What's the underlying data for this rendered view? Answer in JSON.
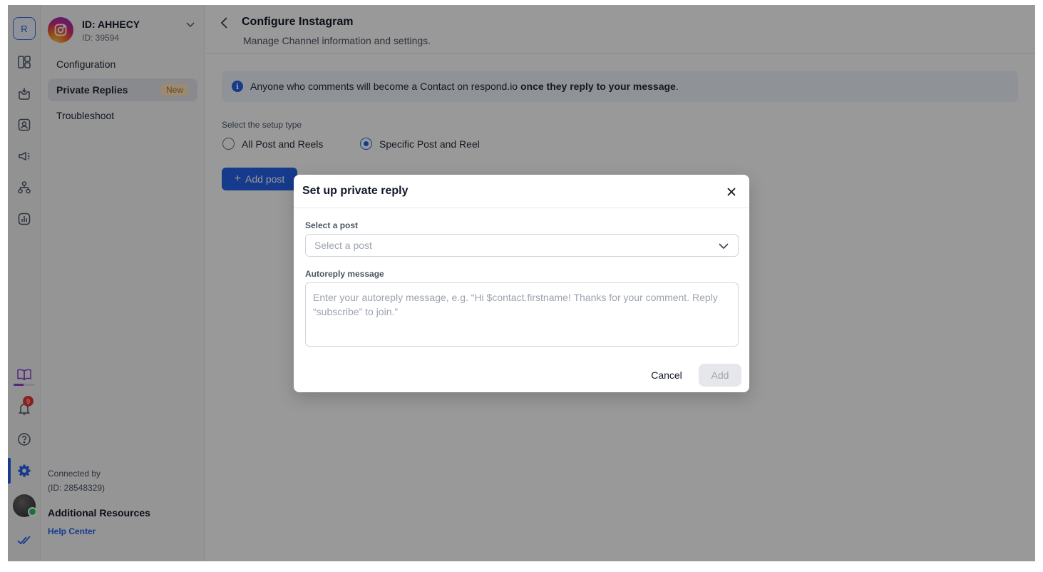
{
  "rail": {
    "workspace_initial": "R",
    "notification_count": "9",
    "onboarding_progress": 0.45,
    "icons": [
      "dashboard-icon",
      "inbox-icon",
      "contacts-icon",
      "broadcasts-icon",
      "workflows-icon",
      "reports-icon",
      "onboarding-book-icon",
      "notifications-bell-icon",
      "help-icon",
      "settings-gear-icon",
      "user-avatar",
      "respond-logo-icon"
    ]
  },
  "sidebar": {
    "account_title": "ID: AHHECY",
    "account_id": "ID: 39594",
    "items": [
      {
        "label": "Configuration"
      },
      {
        "label": "Private Replies",
        "badge": "New"
      },
      {
        "label": "Troubleshoot"
      }
    ],
    "connected_by_label": "Connected by",
    "connected_by_id": "(ID: 28548329)",
    "resources_title": "Additional Resources",
    "help_center": "Help Center"
  },
  "header": {
    "title": "Configure Instagram",
    "subtitle": "Manage Channel information and settings."
  },
  "info_banner": {
    "text_plain": "Anyone who comments will become a Contact on respond.io ",
    "text_bold": "once they reply to your message",
    "text_end": "."
  },
  "setup": {
    "label": "Select the setup type",
    "options": [
      {
        "label": "All Post and Reels",
        "selected": false
      },
      {
        "label": "Specific Post and Reel",
        "selected": true
      }
    ],
    "add_post_label": "Add post"
  },
  "modal": {
    "title": "Set up private reply",
    "post_label": "Select a post",
    "post_placeholder": "Select a post",
    "message_label": "Autoreply message",
    "message_placeholder": "Enter your autoreply message, e.g. “Hi $contact.firstname! Thanks for your comment. Reply “subscribe” to join.”",
    "cancel_label": "Cancel",
    "add_label": "Add"
  },
  "colors": {
    "accent": "#2563eb",
    "new_badge_bg": "#fde7c2",
    "new_badge_text": "#b7791f",
    "notification_badge": "#e53935",
    "online": "#22c55e"
  }
}
